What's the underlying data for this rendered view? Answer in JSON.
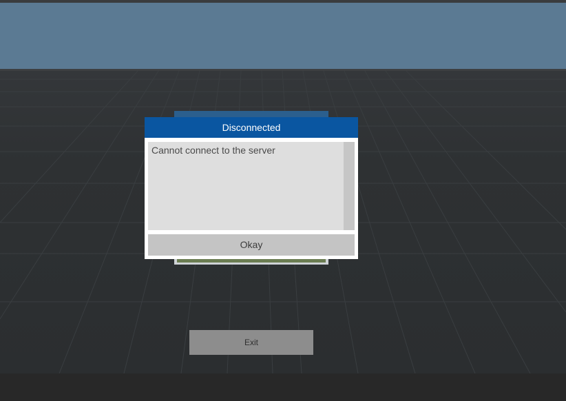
{
  "dialog": {
    "title": "Disconnected",
    "message": "Cannot connect to the server",
    "okay_label": "Okay"
  },
  "menu": {
    "exit_label": "Exit"
  },
  "colors": {
    "dialog_header": "#0a56a1",
    "sky": "#5b7a93",
    "ground": "#2b2e30"
  }
}
